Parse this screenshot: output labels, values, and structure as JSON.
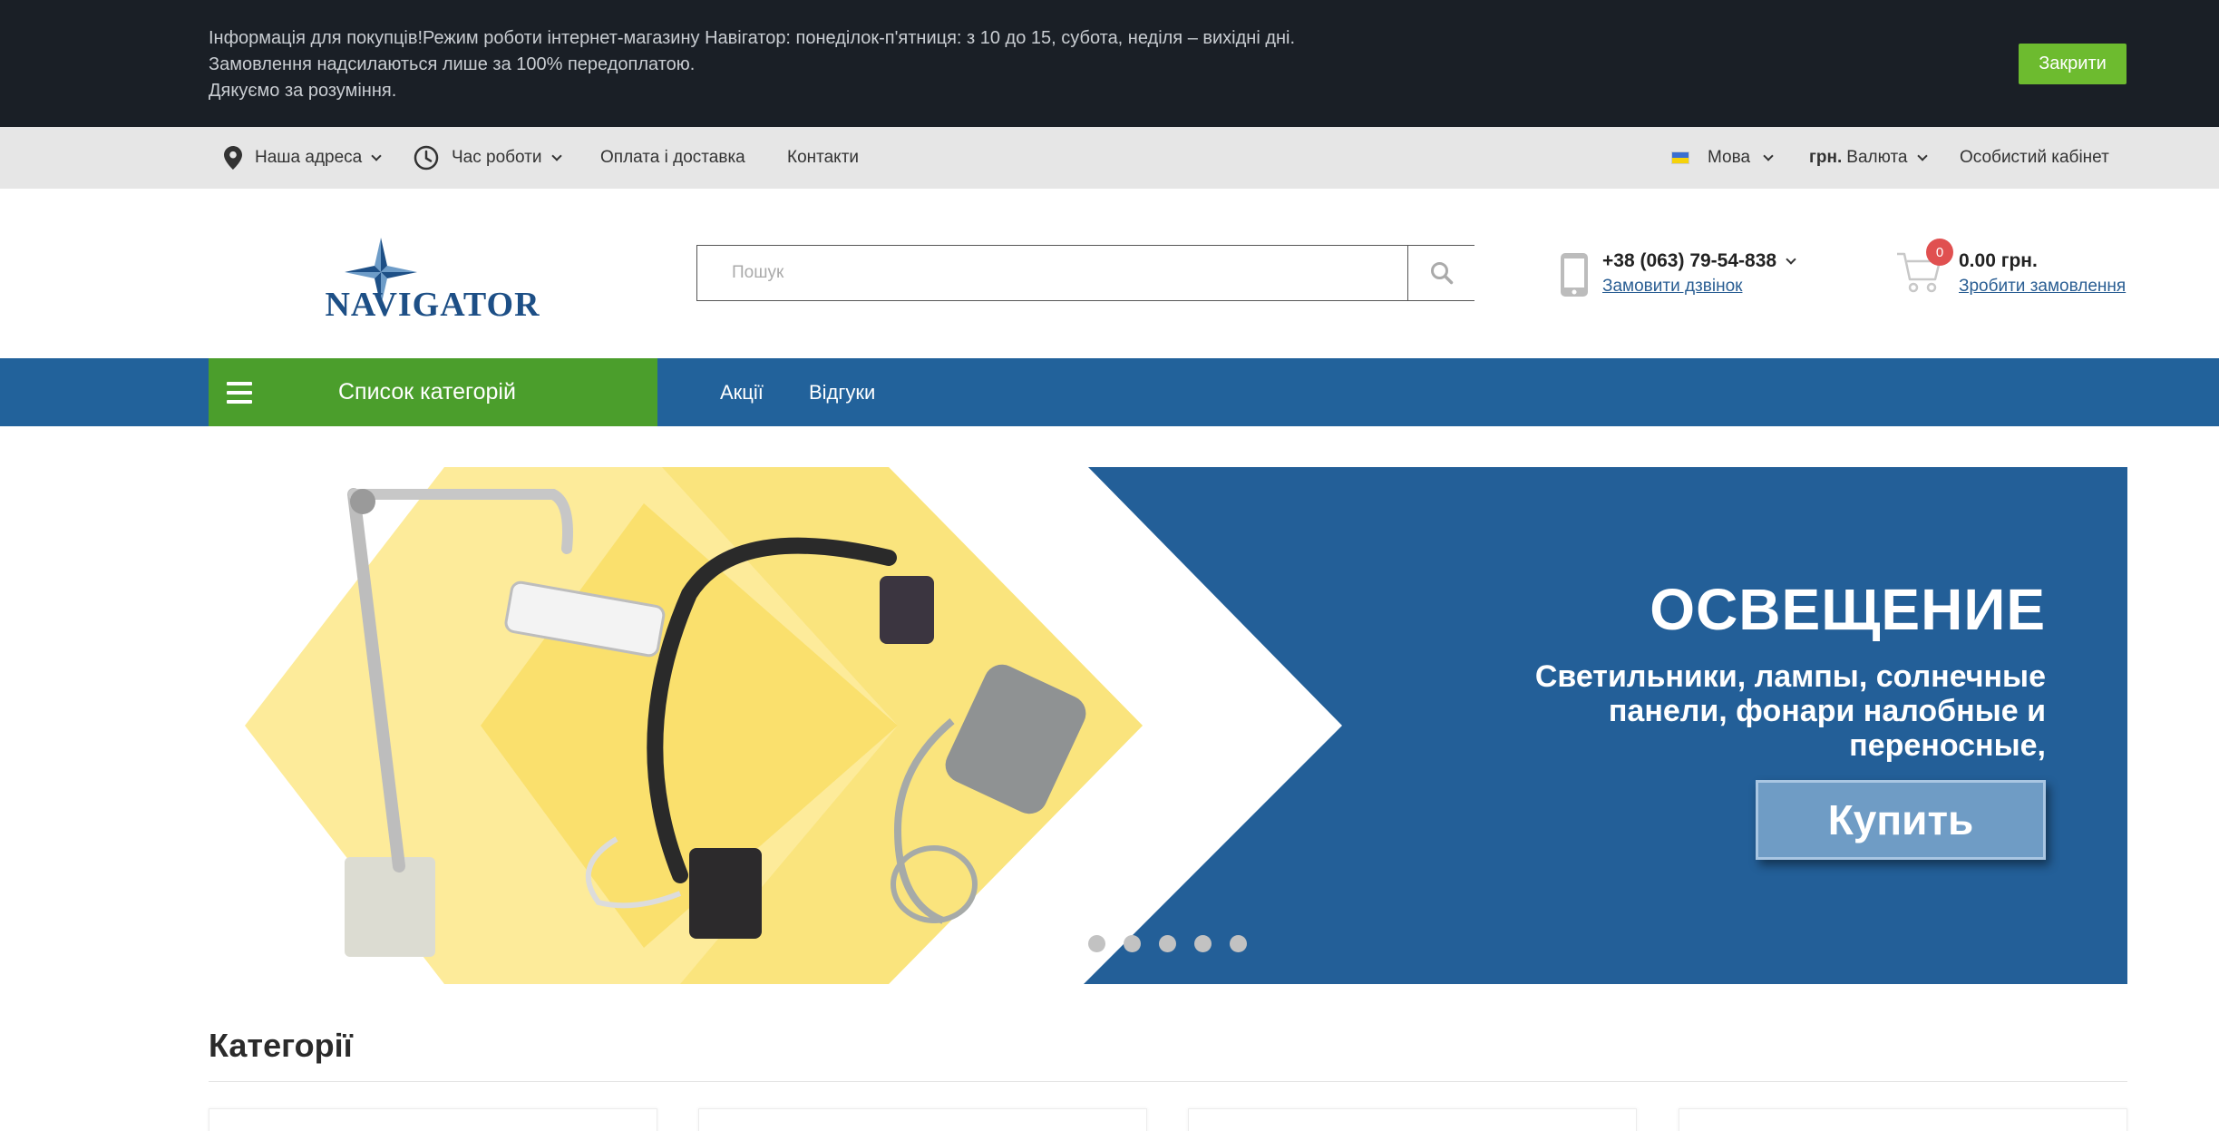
{
  "notice": {
    "lines": [
      "Інформація для покупців!Режим роботи інтернет-магазину Навігатор: понеділок-п'ятниця: з 10 до 15, субота, неділя – вихідні дні.",
      "Замовлення надсилаються лише за 100% передоплатою.",
      "Дякуємо за розуміння."
    ],
    "close_label": "Закрити"
  },
  "topbar": {
    "address": "Наша адреса",
    "hours": "Час роботи",
    "payment": "Оплата і доставка",
    "contacts": "Контакти",
    "language": "Мова",
    "currency_code": "грн.",
    "currency": "Валюта",
    "account": "Особистий кабінет"
  },
  "header": {
    "logo_text": "NAVIGATOR",
    "search_placeholder": "Пошук",
    "phone": "+38 (063) 79-54-838",
    "callback": "Замовити дзвінок",
    "cart_count": "0",
    "cart_total": "0.00 грн.",
    "checkout": "Зробити замовлення"
  },
  "nav": {
    "categories_label": "Список категорій",
    "links": [
      "Акції",
      "Відгуки"
    ]
  },
  "banner": {
    "title": "ОСВЕЩЕНИЕ",
    "subtitle": "Светильники, лампы, солнечные панели, фонари налобные и переносные,",
    "button": "Купить",
    "slide_count": 5
  },
  "categories": {
    "title": "Категорії"
  },
  "colors": {
    "notice_bg": "#1a1f26",
    "accent_green": "#4b9e2c",
    "nav_blue": "#22629b",
    "banner_blue": "#235f98",
    "banner_yellow": "#fbe37a"
  }
}
